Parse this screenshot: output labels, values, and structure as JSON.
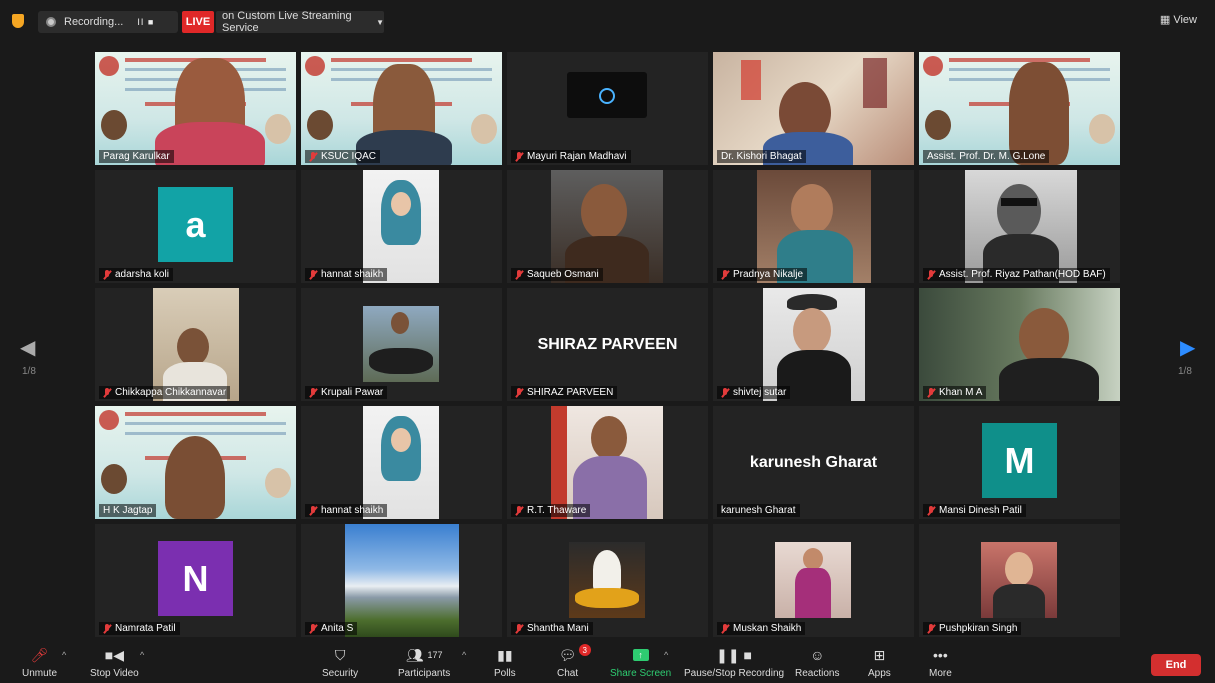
{
  "topbar": {
    "recording_label": "Recording...",
    "recording_controls": "II  ■",
    "live_badge": "LIVE",
    "live_service": "on Custom Live Streaming Service",
    "view_label": "View"
  },
  "pagination": {
    "left_page": "1/8",
    "right_page": "1/8"
  },
  "participants": [
    {
      "name": "Parag Karulkar"
    },
    {
      "name": "KSUC IQAC"
    },
    {
      "name": "Mayuri Rajan Madhavi"
    },
    {
      "name": "Dr. Kishori Bhagat"
    },
    {
      "name": "Assist. Prof. Dr. M. G.Lone"
    },
    {
      "name": "adarsha koli",
      "avatar_letter": "a",
      "avatar_color": "#12a3a6"
    },
    {
      "name": "hannat shaikh"
    },
    {
      "name": "Saqueb Osmani"
    },
    {
      "name": "Pradnya Nikalje"
    },
    {
      "name": "Assist. Prof. Riyaz Pathan(HOD BAF)"
    },
    {
      "name": "Chikkappa Chikkannavar"
    },
    {
      "name": "Krupali Pawar"
    },
    {
      "name": "SHIRAZ PARVEEN",
      "card_text": "SHIRAZ PARVEEN"
    },
    {
      "name": "shivtej sutar"
    },
    {
      "name": "Khan M A"
    },
    {
      "name": "H K Jagtap"
    },
    {
      "name": "hannat shaikh"
    },
    {
      "name": "R.T. Thaware"
    },
    {
      "name": "karunesh Gharat",
      "card_text": "karunesh Gharat"
    },
    {
      "name": "Mansi Dinesh Patil",
      "avatar_letter": "M",
      "avatar_color": "#0f8f8a"
    },
    {
      "name": "Namrata Patil",
      "avatar_letter": "N",
      "avatar_color": "#7b2fb0"
    },
    {
      "name": "Anita S"
    },
    {
      "name": "Shantha Mani"
    },
    {
      "name": "Muskan Shaikh"
    },
    {
      "name": "Pushpkiran Singh"
    }
  ],
  "toolbar": {
    "unmute": "Unmute",
    "stop_video": "Stop Video",
    "security": "Security",
    "participants": "Participants",
    "participant_count": "177",
    "polls": "Polls",
    "chat": "Chat",
    "chat_badge": "3",
    "share_screen": "Share Screen",
    "pause_recording": "Pause/Stop Recording",
    "reactions": "Reactions",
    "apps": "Apps",
    "more": "More",
    "end": "End"
  },
  "colors": {
    "live_red": "#e02828",
    "share_green": "#2ecc71",
    "active_speaker": "#e9e96a",
    "end_red": "#d32f2f"
  }
}
